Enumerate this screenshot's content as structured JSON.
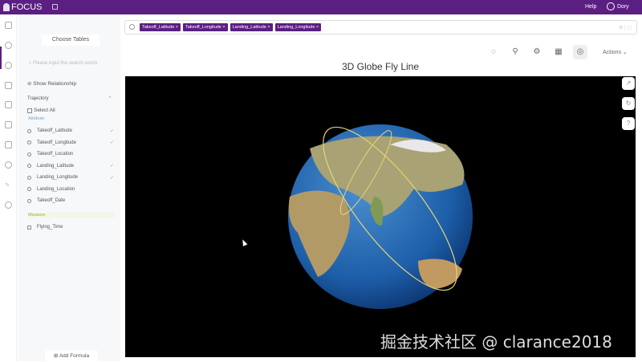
{
  "app": {
    "name": "FOCUS",
    "help": "Help",
    "user": "Dory"
  },
  "panel": {
    "choose_tables": "Choose Tables",
    "search_placeholder": "Please input the search words",
    "show_relationship": "Show Relationship",
    "table": "Trajectory",
    "select_all": "Select All",
    "attribute_label": "Attribute",
    "measure_label": "Measure",
    "attributes": [
      {
        "name": "Takeoff_Latitude",
        "checked": true
      },
      {
        "name": "Takeoff_Longitude",
        "checked": true
      },
      {
        "name": "Takeoff_Location",
        "checked": false
      },
      {
        "name": "Landing_Latitude",
        "checked": true
      },
      {
        "name": "Landing_Longitude",
        "checked": true
      },
      {
        "name": "Landing_Location",
        "checked": false
      },
      {
        "name": "Takeoff_Date",
        "checked": false
      }
    ],
    "measures": [
      {
        "name": "Flying_Time"
      }
    ],
    "add_formula": "Add Formula"
  },
  "query": {
    "tags": [
      "Takeoff_Latitude",
      "Takeoff_Longitude",
      "Landing_Latitude",
      "Landing_Longitude"
    ]
  },
  "chart": {
    "title": "3D Globe Fly Line",
    "actions": "Actions"
  },
  "watermark": "掘金技术社区 @ clarance2018",
  "colors": {
    "brand": "#5b1f82",
    "fly_line": "#e8d27a"
  }
}
